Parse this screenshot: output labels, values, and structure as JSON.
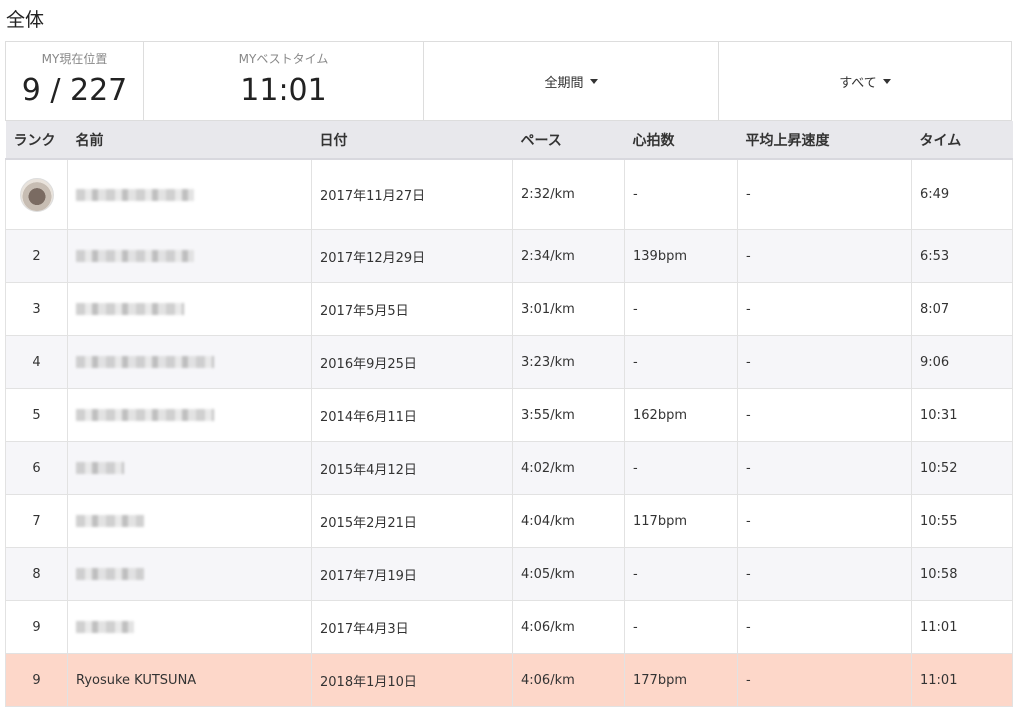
{
  "page": {
    "title": "全体"
  },
  "summary": {
    "my_position": {
      "label": "MY現在位置",
      "value": "9 / 227"
    },
    "my_best": {
      "label": "MYベストタイム",
      "value": "11:01"
    },
    "period_filter": {
      "label": "全期間",
      "icon": "caret-down-icon"
    },
    "type_filter": {
      "label": "すべて",
      "icon": "caret-down-icon"
    }
  },
  "table": {
    "headers": [
      "ランク",
      "名前",
      "日付",
      "ペース",
      "心拍数",
      "平均上昇速度",
      "タイム"
    ],
    "rows": [
      {
        "rank": "",
        "name": "",
        "date": "2017年11月27日",
        "pace": "2:32/km",
        "hr": "-",
        "climb": "-",
        "time": "6:49"
      },
      {
        "rank": "2",
        "name": "",
        "date": "2017年12月29日",
        "pace": "2:34/km",
        "hr": "139bpm",
        "climb": "-",
        "time": "6:53"
      },
      {
        "rank": "3",
        "name": "",
        "date": "2017年5月5日",
        "pace": "3:01/km",
        "hr": "-",
        "climb": "-",
        "time": "8:07"
      },
      {
        "rank": "4",
        "name": "",
        "date": "2016年9月25日",
        "pace": "3:23/km",
        "hr": "-",
        "climb": "-",
        "time": "9:06"
      },
      {
        "rank": "5",
        "name": "",
        "date": "2014年6月11日",
        "pace": "3:55/km",
        "hr": "162bpm",
        "climb": "-",
        "time": "10:31"
      },
      {
        "rank": "6",
        "name": "",
        "date": "2015年4月12日",
        "pace": "4:02/km",
        "hr": "-",
        "climb": "-",
        "time": "10:52"
      },
      {
        "rank": "7",
        "name": "",
        "date": "2015年2月21日",
        "pace": "4:04/km",
        "hr": "117bpm",
        "climb": "-",
        "time": "10:55"
      },
      {
        "rank": "8",
        "name": "",
        "date": "2017年7月19日",
        "pace": "4:05/km",
        "hr": "-",
        "climb": "-",
        "time": "10:58"
      },
      {
        "rank": "9",
        "name": "",
        "date": "2017年4月3日",
        "pace": "4:06/km",
        "hr": "-",
        "climb": "-",
        "time": "11:01"
      },
      {
        "rank": "9",
        "name": "Ryosuke KUTSUNA",
        "date": "2018年1月10日",
        "pace": "4:06/km",
        "hr": "177bpm",
        "climb": "-",
        "time": "11:01",
        "highlight": true
      }
    ]
  },
  "colors": {
    "date_link": "#2a7ab8",
    "self_row": "#fdd7c9",
    "header_bg": "#e8e8ec"
  }
}
